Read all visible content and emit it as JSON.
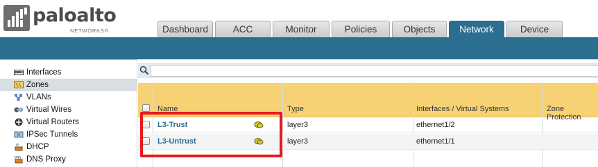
{
  "brand": {
    "name": "paloalto",
    "sub": "NETWORKS®"
  },
  "tabs": [
    {
      "label": "Dashboard",
      "active": false
    },
    {
      "label": "ACC",
      "active": false
    },
    {
      "label": "Monitor",
      "active": false
    },
    {
      "label": "Policies",
      "active": false
    },
    {
      "label": "Objects",
      "active": false
    },
    {
      "label": "Network",
      "active": true
    },
    {
      "label": "Device",
      "active": false
    }
  ],
  "sidebar": {
    "items": [
      {
        "label": "Interfaces",
        "icon": "interfaces-icon",
        "selected": false
      },
      {
        "label": "Zones",
        "icon": "zones-icon",
        "selected": true
      },
      {
        "label": "VLANs",
        "icon": "vlans-icon",
        "selected": false
      },
      {
        "label": "Virtual Wires",
        "icon": "virtual-wires-icon",
        "selected": false
      },
      {
        "label": "Virtual Routers",
        "icon": "virtual-routers-icon",
        "selected": false
      },
      {
        "label": "IPSec Tunnels",
        "icon": "ipsec-tunnels-icon",
        "selected": false
      },
      {
        "label": "DHCP",
        "icon": "dhcp-icon",
        "selected": false
      },
      {
        "label": "DNS Proxy",
        "icon": "dns-proxy-icon",
        "selected": false
      }
    ]
  },
  "search": {
    "value": "",
    "placeholder": ""
  },
  "table": {
    "columns": [
      "Name",
      "Type",
      "Interfaces / Virtual Systems",
      "Zone Protection"
    ],
    "rows": [
      {
        "name": "L3-Trust",
        "type": "layer3",
        "interfaces": "ethernet1/2",
        "zone_protection": ""
      },
      {
        "name": "L3-Untrust",
        "type": "layer3",
        "interfaces": "ethernet1/1",
        "zone_protection": ""
      }
    ]
  },
  "colors": {
    "accent": "#2c6e8f",
    "header_bg": "#f7d275",
    "highlight": "#e8191c",
    "link": "#2b6a92"
  }
}
